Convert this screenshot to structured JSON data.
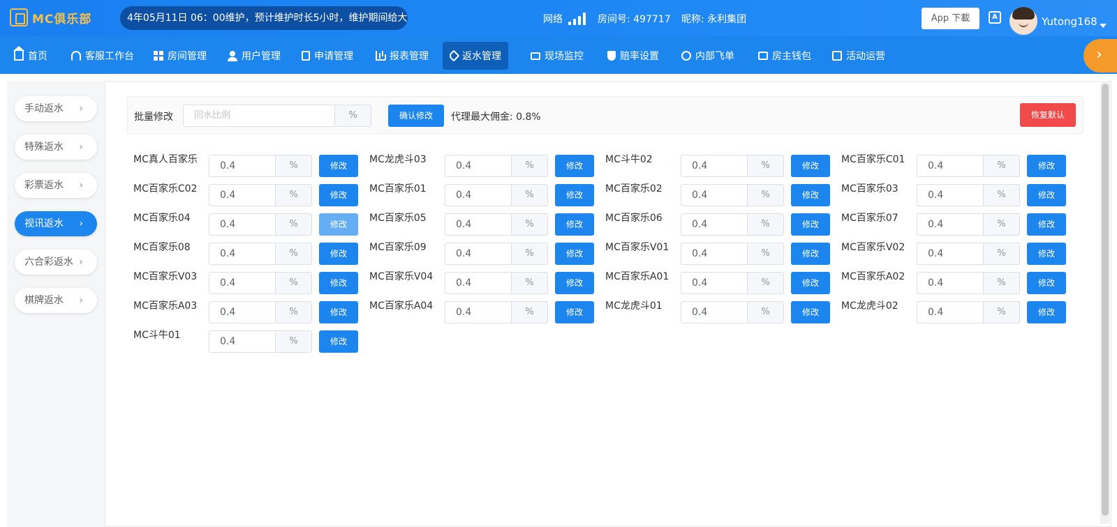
{
  "header": {
    "logo": "MC俱乐部",
    "notice": "4年05月11日 06：00维护，预计维护时长5小时，维护期间给大家",
    "network_label": "网络",
    "room": "房间号: 497717",
    "nickname": "昵称: 永利集团",
    "app_download": "App 下載",
    "lang_icon_text": "A",
    "username": "Yutong168"
  },
  "nav": [
    {
      "label": "首页",
      "icon": "home-icon"
    },
    {
      "label": "客服工作台",
      "icon": "headset-icon"
    },
    {
      "label": "房间管理",
      "icon": "grid-icon"
    },
    {
      "label": "用户管理",
      "icon": "user-icon"
    },
    {
      "label": "申请管理",
      "icon": "document-icon"
    },
    {
      "label": "报表管理",
      "icon": "chart-icon"
    },
    {
      "label": "返水管理",
      "icon": "tag-icon",
      "active": true
    },
    {
      "label": "现场监控",
      "icon": "monitor-icon"
    },
    {
      "label": "赔率设置",
      "icon": "shield-icon"
    },
    {
      "label": "内部飞单",
      "icon": "clock-icon"
    },
    {
      "label": "房主钱包",
      "icon": "wallet-icon"
    },
    {
      "label": "活动运营",
      "icon": "gift-icon"
    }
  ],
  "sidebar": [
    {
      "label": "手动返水",
      "active": false
    },
    {
      "label": "特殊返水",
      "active": false
    },
    {
      "label": "彩票返水",
      "active": false
    },
    {
      "label": "视讯返水",
      "active": true
    },
    {
      "label": "六合彩返水",
      "active": false
    },
    {
      "label": "棋牌返水",
      "active": false
    }
  ],
  "batch": {
    "label": "批量修改",
    "placeholder": "回水比例",
    "unit": "%",
    "confirm": "确认修改",
    "agent_max": "代理最大佣金: 0.8%",
    "reset": "恢复默认"
  },
  "items": [
    {
      "name": "MC真人百家乐",
      "value": "0.4"
    },
    {
      "name": "MC龙虎斗03",
      "value": "0.4"
    },
    {
      "name": "MC斗牛02",
      "value": "0.4"
    },
    {
      "name": "MC百家乐C01",
      "value": "0.4"
    },
    {
      "name": "MC百家乐C02",
      "value": "0.4"
    },
    {
      "name": "MC百家乐01",
      "value": "0.4"
    },
    {
      "name": "MC百家乐02",
      "value": "0.4"
    },
    {
      "name": "MC百家乐03",
      "value": "0.4"
    },
    {
      "name": "MC百家乐04",
      "value": "0.4",
      "hover": true
    },
    {
      "name": "MC百家乐05",
      "value": "0.4"
    },
    {
      "name": "MC百家乐06",
      "value": "0.4"
    },
    {
      "name": "MC百家乐07",
      "value": "0.4"
    },
    {
      "name": "MC百家乐08",
      "value": "0.4"
    },
    {
      "name": "MC百家乐09",
      "value": "0.4"
    },
    {
      "name": "MC百家乐V01",
      "value": "0.4"
    },
    {
      "name": "MC百家乐V02",
      "value": "0.4"
    },
    {
      "name": "MC百家乐V03",
      "value": "0.4"
    },
    {
      "name": "MC百家乐V04",
      "value": "0.4"
    },
    {
      "name": "MC百家乐A01",
      "value": "0.4"
    },
    {
      "name": "MC百家乐A02",
      "value": "0.4"
    },
    {
      "name": "MC百家乐A03",
      "value": "0.4"
    },
    {
      "name": "MC百家乐A04",
      "value": "0.4"
    },
    {
      "name": "MC龙虎斗01",
      "value": "0.4"
    },
    {
      "name": "MC龙虎斗02",
      "value": "0.4"
    },
    {
      "name": "MC斗牛01",
      "value": "0.4"
    }
  ],
  "item_unit": "%",
  "item_button": "修改"
}
